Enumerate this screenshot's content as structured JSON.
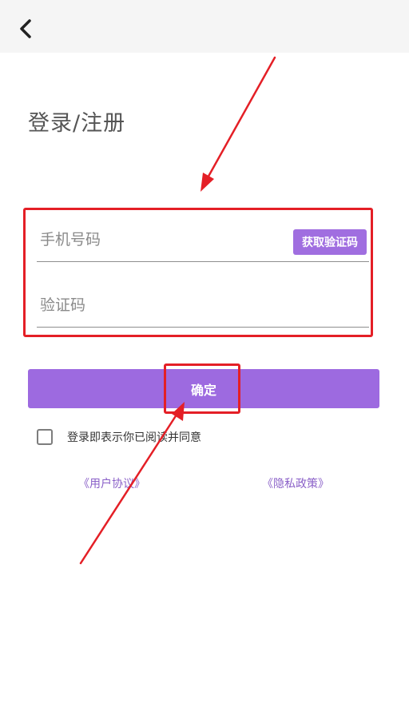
{
  "header": {
    "back_icon": "chevron-left-icon"
  },
  "login": {
    "title": "登录/注册",
    "phone_placeholder": "手机号码",
    "get_code_label": "获取验证码",
    "code_placeholder": "验证码",
    "confirm_label": "确定",
    "agreement_text": "登录即表示你已阅读并同意",
    "user_agreement_link": "《用户协议》",
    "privacy_policy_link": "《隐私政策》"
  },
  "colors": {
    "accent": "#9d6ae0",
    "annotation": "#e41f26",
    "link": "#8a60c8"
  }
}
